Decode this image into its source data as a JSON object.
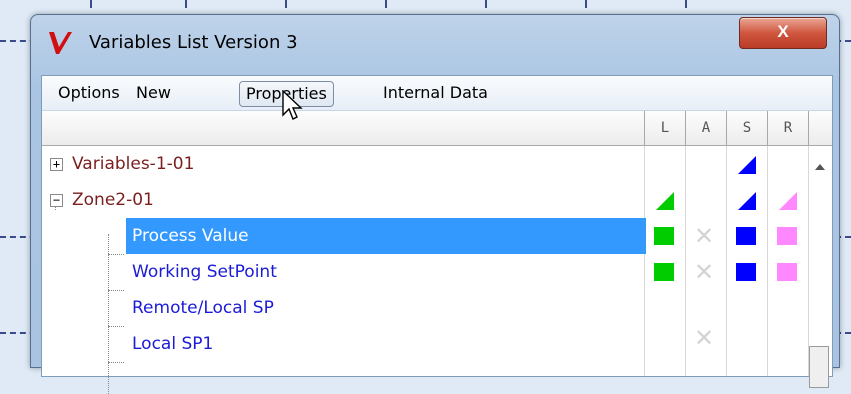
{
  "window": {
    "title": "Variables List Version 3",
    "close_label": "X"
  },
  "menu": [
    "Options",
    "New",
    "Properties",
    "Internal Data"
  ],
  "columns": [
    "L",
    "A",
    "S",
    "R"
  ],
  "tree": [
    {
      "label": "Variables-1-01",
      "color": "maroon",
      "expander": "+",
      "level": 0,
      "selected": false,
      "indicators": {
        "L": null,
        "A": null,
        "S": {
          "shape": "triangle",
          "color": "#0000ff"
        },
        "R": null
      }
    },
    {
      "label": "Zone2-01",
      "color": "maroon",
      "expander": "−",
      "level": 0,
      "selected": false,
      "indicators": {
        "L": {
          "shape": "triangle",
          "color": "#00cc00"
        },
        "A": null,
        "S": {
          "shape": "triangle",
          "color": "#0000ff"
        },
        "R": {
          "shape": "triangle",
          "color": "#ff66ff"
        }
      }
    },
    {
      "label": "Process Value",
      "color": "blue",
      "expander": null,
      "level": 1,
      "selected": true,
      "indicators": {
        "L": {
          "shape": "square",
          "color": "#00cc00"
        },
        "A": {
          "shape": "x"
        },
        "S": {
          "shape": "square",
          "color": "#0000ff"
        },
        "R": {
          "shape": "square",
          "color": "#ff88ff"
        }
      }
    },
    {
      "label": "Working SetPoint",
      "color": "blue",
      "expander": null,
      "level": 1,
      "selected": false,
      "indicators": {
        "L": {
          "shape": "square",
          "color": "#00cc00"
        },
        "A": {
          "shape": "x"
        },
        "S": {
          "shape": "square",
          "color": "#0000ff"
        },
        "R": {
          "shape": "square",
          "color": "#ff88ff"
        }
      }
    },
    {
      "label": "Remote/Local SP",
      "color": "blue",
      "expander": null,
      "level": 1,
      "selected": false,
      "indicators": {
        "L": null,
        "A": null,
        "S": null,
        "R": null
      }
    },
    {
      "label": "Local SP1",
      "color": "blue",
      "expander": null,
      "level": 1,
      "selected": false,
      "indicators": {
        "L": null,
        "A": {
          "shape": "x"
        },
        "S": null,
        "R": null
      }
    }
  ],
  "colors": {
    "selection": "#3399ff",
    "maroon": "#7a1f1f",
    "blue": "#1b1bd6"
  }
}
